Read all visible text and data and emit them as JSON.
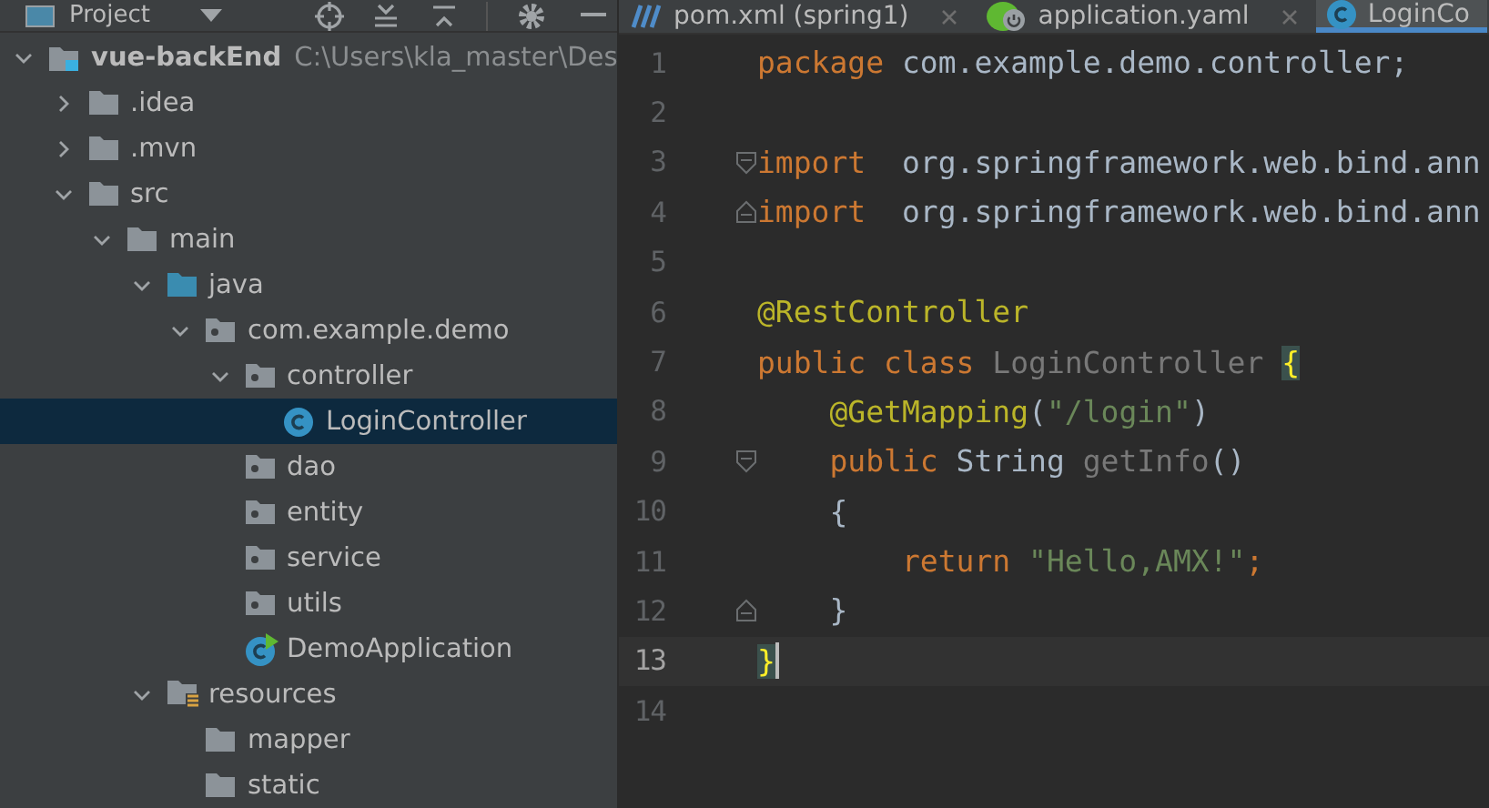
{
  "project_panel": {
    "title": "Project",
    "tree": [
      {
        "name": "vue-backEnd",
        "path": "C:\\Users\\kla_master\\Des",
        "kind": "module",
        "expanded": true,
        "selected": false,
        "children": [
          {
            "name": ".idea",
            "kind": "folder",
            "expanded": false,
            "selected": false
          },
          {
            "name": ".mvn",
            "kind": "folder",
            "expanded": false,
            "selected": false
          },
          {
            "name": "src",
            "kind": "folder",
            "expanded": true,
            "selected": false,
            "children": [
              {
                "name": "main",
                "kind": "folder",
                "expanded": true,
                "selected": false,
                "children": [
                  {
                    "name": "java",
                    "kind": "source",
                    "expanded": true,
                    "selected": false,
                    "children": [
                      {
                        "name": "com.example.demo",
                        "kind": "package",
                        "expanded": true,
                        "selected": false,
                        "children": [
                          {
                            "name": "controller",
                            "kind": "package",
                            "expanded": true,
                            "selected": false,
                            "children": [
                              {
                                "name": "LoginController",
                                "kind": "class",
                                "selected": true
                              }
                            ]
                          },
                          {
                            "name": "dao",
                            "kind": "package",
                            "selected": false
                          },
                          {
                            "name": "entity",
                            "kind": "package",
                            "selected": false
                          },
                          {
                            "name": "service",
                            "kind": "package",
                            "selected": false
                          },
                          {
                            "name": "utils",
                            "kind": "package",
                            "selected": false
                          },
                          {
                            "name": "DemoApplication",
                            "kind": "main",
                            "selected": false
                          }
                        ]
                      }
                    ]
                  },
                  {
                    "name": "resources",
                    "kind": "resources",
                    "expanded": true,
                    "selected": false,
                    "children": [
                      {
                        "name": "mapper",
                        "kind": "folder",
                        "selected": false
                      },
                      {
                        "name": "static",
                        "kind": "folder",
                        "selected": false
                      }
                    ]
                  }
                ]
              }
            ]
          }
        ]
      }
    ]
  },
  "editor": {
    "tabs": [
      {
        "label": "pom.xml (spring1)",
        "kind": "maven",
        "selected": false,
        "closable": true
      },
      {
        "label": "application.yaml",
        "kind": "spring",
        "selected": false,
        "closable": true
      },
      {
        "label": "LoginCo",
        "kind": "class",
        "selected": true,
        "closable": false
      }
    ],
    "lines": [
      {
        "number": "1",
        "kind": "plain",
        "tokens": [
          {
            "kind": "keyword",
            "text": "package"
          },
          {
            "kind": "plain",
            "text": " com.example.demo.controller;"
          }
        ]
      },
      {
        "number": "2",
        "kind": "plain"
      },
      {
        "number": "3",
        "kind": "fold-start",
        "tokens": [
          {
            "kind": "keyword",
            "text": "import"
          },
          {
            "kind": "plain",
            "text": "  org.springframework.web.bind.ann"
          }
        ]
      },
      {
        "number": "4",
        "kind": "fold-end",
        "tokens": [
          {
            "kind": "keyword",
            "text": "import"
          },
          {
            "kind": "plain",
            "text": "  org.springframework.web.bind.ann"
          }
        ]
      },
      {
        "number": "5",
        "kind": "plain"
      },
      {
        "number": "6",
        "kind": "plain",
        "tokens": [
          {
            "kind": "annotation",
            "text": "@RestController"
          }
        ]
      },
      {
        "number": "7",
        "kind": "plain",
        "tokens": [
          {
            "kind": "keyword",
            "text": "public class "
          },
          {
            "kind": "unused",
            "text": "LoginController "
          },
          {
            "kind": "brace-match",
            "text": "{"
          }
        ]
      },
      {
        "number": "8",
        "kind": "plain",
        "tokens": [
          {
            "kind": "annotation",
            "text": "    @GetMapping"
          },
          {
            "kind": "plain",
            "text": "("
          },
          {
            "kind": "string",
            "text": "\"/login\""
          },
          {
            "kind": "plain",
            "text": ")"
          }
        ]
      },
      {
        "number": "9",
        "kind": "fold-start",
        "tokens": [
          {
            "kind": "keyword",
            "text": "    public "
          },
          {
            "kind": "plain",
            "text": "String "
          },
          {
            "kind": "unused",
            "text": "getInfo"
          },
          {
            "kind": "plain",
            "text": "()"
          }
        ]
      },
      {
        "number": "10",
        "kind": "plain",
        "tokens": [
          {
            "kind": "plain",
            "text": "    {"
          }
        ]
      },
      {
        "number": "11",
        "kind": "plain",
        "tokens": [
          {
            "kind": "keyword",
            "text": "        return "
          },
          {
            "kind": "string",
            "text": "\"Hello,AMX!\""
          },
          {
            "kind": "keyword",
            "text": ";"
          }
        ]
      },
      {
        "number": "12",
        "kind": "fold-end",
        "tokens": [
          {
            "kind": "plain",
            "text": "    }"
          }
        ]
      },
      {
        "number": "13",
        "kind": "plain",
        "current": true,
        "tokens": [
          {
            "kind": "brace-match",
            "text": "}"
          }
        ]
      },
      {
        "number": "14",
        "kind": "plain"
      }
    ]
  }
}
